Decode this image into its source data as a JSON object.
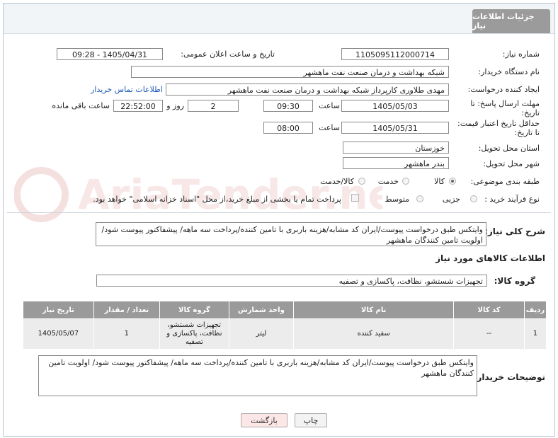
{
  "header": {
    "tab_title": "جزئیات اطلاعات نیاز"
  },
  "form": {
    "need_number_label": "شماره نیاز:",
    "need_number": "1105095112000714",
    "announce_label": "تاریخ و ساعت اعلان عمومی:",
    "announce_value": "1405/04/31 - 09:28",
    "buyer_org_label": "نام دستگاه خریدار:",
    "buyer_org": "شبکه بهداشت و درمان صنعت نفت ماهشهر",
    "creator_label": "ایجاد کننده درخواست:",
    "creator": "مهدی طلاوری کارپرداز شبکه بهداشت و درمان صنعت نفت ماهشهر",
    "buyer_contact_link": "اطلاعات تماس خریدار",
    "deadline_label_1": "مهلت ارسال پاسخ: تا",
    "deadline_label_2": "تاریخ:",
    "deadline_date": "1405/05/03",
    "time_label": "ساعت",
    "deadline_time": "09:30",
    "days_value": "2",
    "days_label": "روز و",
    "remaining_time": "22:52:00",
    "remaining_label": "ساعت باقی مانده",
    "validity_label_1": "حداقل تاریخ اعتبار قیمت:",
    "validity_label_2": "تا تاریخ:",
    "validity_date": "1405/05/31",
    "validity_time": "08:00",
    "province_label": "استان محل تحویل:",
    "province": "خوزستان",
    "city_label": "شهر محل تحویل:",
    "city": "بندر ماهشهر",
    "category_label": "طبقه بندی موضوعی:",
    "category_options": [
      "کالا",
      "خدمت",
      "کالا/خدمت"
    ],
    "category_selected": "کالا",
    "process_label": "نوع فرآیند خرید :",
    "process_options": [
      "جزیی",
      "متوسط"
    ],
    "payment_note": "پرداخت تمام یا بخشی از مبلغ خرید،از محل \"اسناد خزانه اسلامی\" خواهد بود."
  },
  "description": {
    "label": "شرح کلی نیاز:",
    "text": "وایتکس طبق درخواست پیوست/ایران کد مشابه/هزینه باربری با تامین کننده/پرداخت سه ماهه/ پیشفاکتور پیوست شود/اولویت تامین کنندگان ماهشهر"
  },
  "goods": {
    "section_title": "اطلاعات کالاهای مورد نیاز",
    "group_label": "گروه کالا:",
    "group_value": "تجهیزات شستشو، نظافت، پاکسازی و تصفیه",
    "columns": [
      "ردیف",
      "کد کالا",
      "نام کالا",
      "واحد شمارش",
      "گروه کالا",
      "تعداد / مقدار",
      "تاریخ نیاز"
    ],
    "rows": [
      [
        "1",
        "--",
        "سفید کننده",
        "لیتر",
        "تجهیزات شستشو، نظافت، پاکسازی و تصفیه",
        "1",
        "1405/05/07"
      ]
    ]
  },
  "buyer_notes": {
    "label": "توضیحات خریدار:",
    "text": "وایتکس طبق درخواست پیوست/ایران کد مشابه/هزینه باربری با تامین کننده/پرداخت سه ماهه/ پیشفاکتور پیوست شود/ اولویت تامین کنندگان ماهشهر"
  },
  "buttons": {
    "print": "چاپ",
    "back": "بازگشت"
  },
  "colors": {
    "header_tab": "#9b9b9b",
    "link": "#1c58b8",
    "back_button_bg": "#fce6e6",
    "table_header": "#9a9a9a",
    "watermark": "#f3d6d6"
  },
  "watermark_text": "AriaTender.net"
}
